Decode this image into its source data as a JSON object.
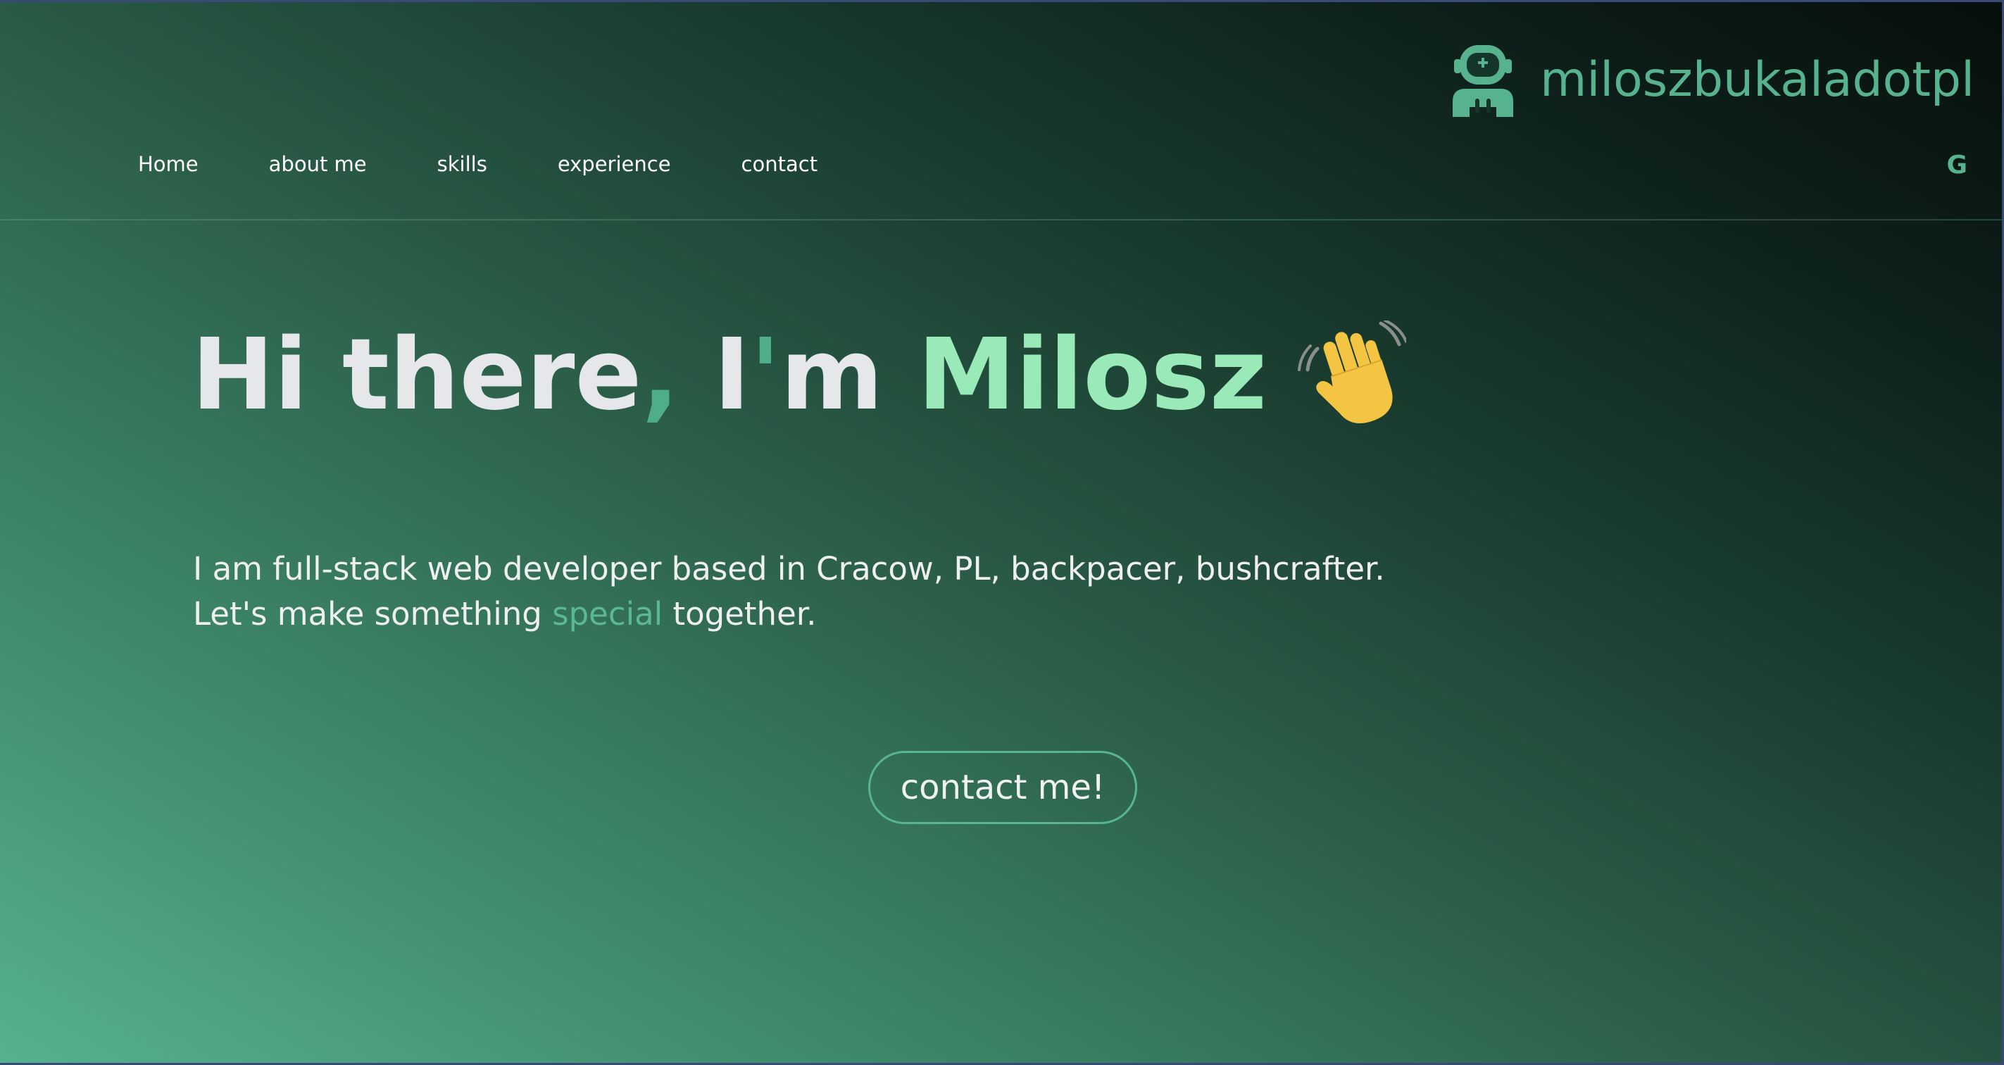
{
  "brand": {
    "name": "miloszbukaladotpl",
    "icon": "astronaut-icon"
  },
  "nav": {
    "items": [
      {
        "label": "Home"
      },
      {
        "label": "about me"
      },
      {
        "label": "skills"
      },
      {
        "label": "experience"
      },
      {
        "label": "contact"
      }
    ],
    "translate_label": "G",
    "translate_icon": "google-translate-icon"
  },
  "hero": {
    "title": {
      "part1": "Hi there",
      "comma": ",",
      "part2": " I",
      "apostrophe": "'",
      "part3": "m ",
      "name": "Milosz",
      "emoji": "waving-hand-icon"
    },
    "line1": "I am full-stack web developer based in Cracow, PL, backpacer, bushcrafter.",
    "line2_start": "Let's make something ",
    "line2_accent": "special",
    "line2_end": " together.",
    "cta_label": "contact me!"
  },
  "colors": {
    "accent": "#57b38e",
    "name_accent": "#9ae9b8",
    "text": "#e6e7ea"
  }
}
